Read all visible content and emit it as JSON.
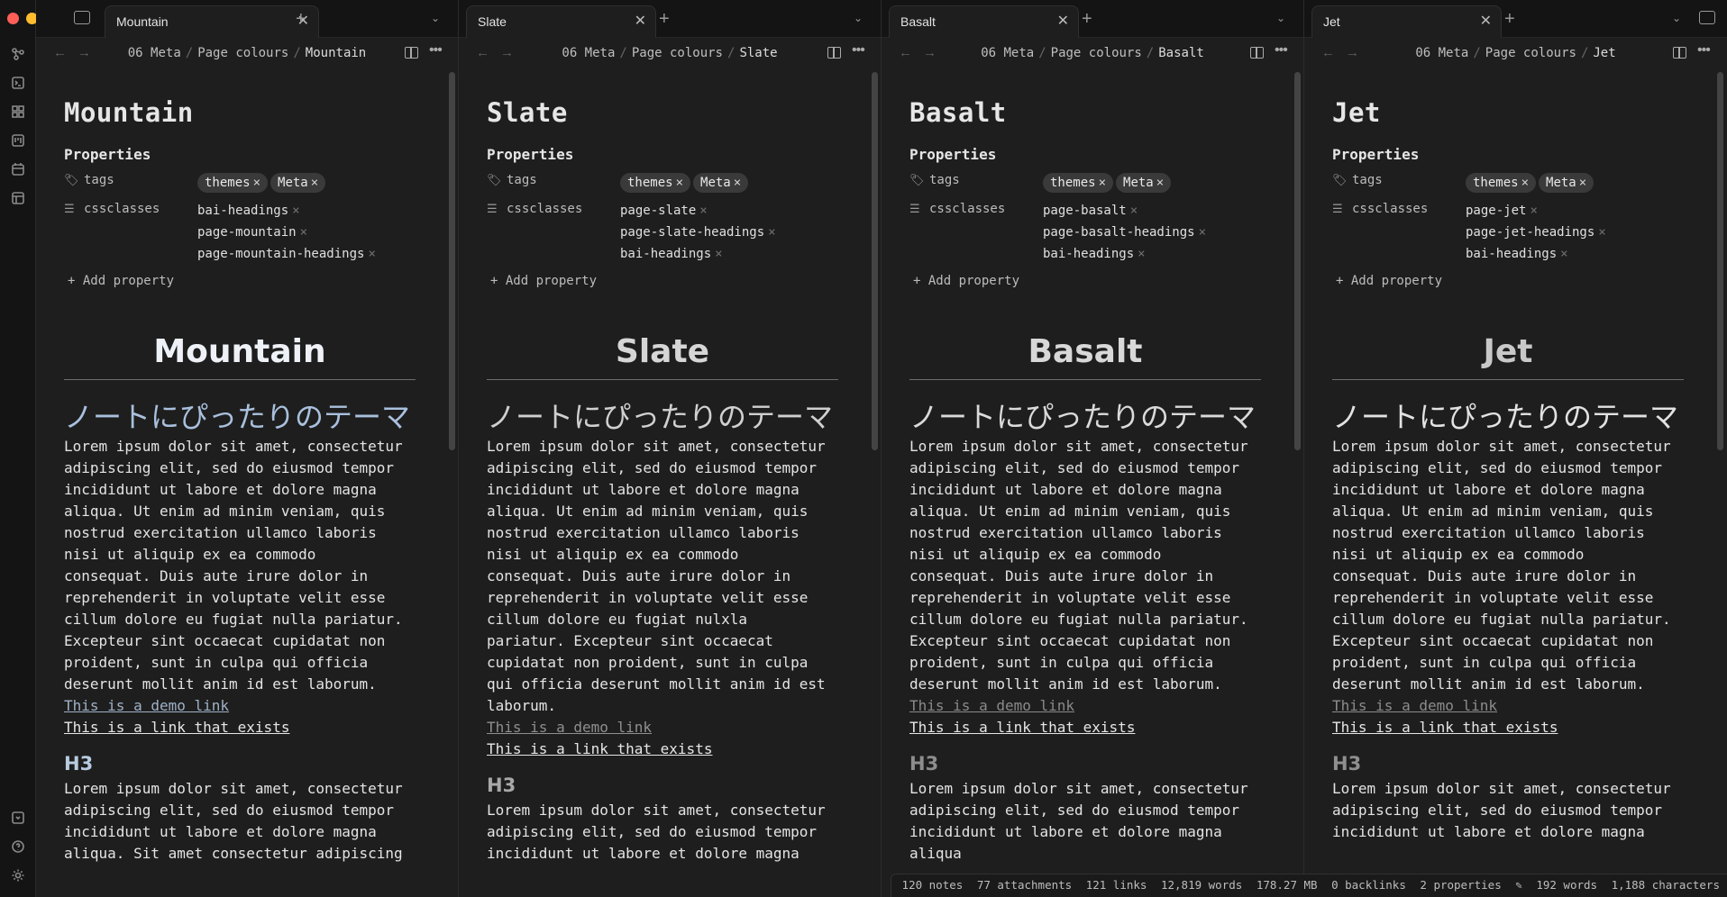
{
  "colors": {
    "mountain_heading": "#eef2f7",
    "mountain_jp": "#a9c0dd",
    "mountain_link": "#9fb2c8",
    "mountain_h3": "#b8cbe0",
    "slate_heading": "#d6d6d6",
    "slate_jp": "#d0d0d0",
    "slate_link": "#8f8f8f",
    "slate_h3": "#a8a8a8",
    "basalt_heading": "#d8d8d8",
    "basalt_jp": "#dadada",
    "basalt_link": "#8a8a8a",
    "basalt_h3": "#8d8d8d",
    "jet_heading": "#c8c8c8",
    "jet_jp": "#e2e2e2",
    "jet_link": "#8c8c8c",
    "jet_h3": "#8f8f8f"
  },
  "ribbon": {
    "icons": [
      "graph-icon",
      "terminal-icon",
      "blocks-icon",
      "kanban-icon",
      "calendar-icon",
      "layout-icon",
      "vault-icon",
      "help-icon",
      "settings-icon"
    ]
  },
  "props_heading": "Properties",
  "tags_key": "tags",
  "cssclasses_key": "cssclasses",
  "add_property": "Add property",
  "tab_close": "✕",
  "tab_new": "+",
  "tag_remove": "×",
  "breadcrumb": {
    "folder": "06 Meta",
    "sub": "Page colours",
    "sep": "/"
  },
  "demo_link": "This is a demo link",
  "exists_link": "This is a link that exists",
  "jp_heading": "ノートにぴったりのテーマ",
  "h3": "H3",
  "panes": [
    {
      "title": "Mountain",
      "tags": [
        "themes",
        "Meta"
      ],
      "cssclasses": [
        "bai-headings",
        "page-mountain",
        "page-mountain-headings"
      ],
      "body": "Lorem ipsum dolor sit amet, consectetur\nadipiscing elit, sed do eiusmod tempor\nincididunt ut labore et dolore magna\naliqua. Ut enim ad minim veniam, quis\nnostrud exercitation ullamco laboris\nnisi ut aliquip ex ea commodo\nconsequat. Duis aute irure dolor in\nreprehenderit in voluptate velit esse\ncillum dolore eu fugiat nulla pariatur.\nExcepteur sint occaecat cupidatat non\nproident, sunt in culpa qui officia\ndeserunt mollit anim id est laborum.",
      "body2": "Lorem ipsum dolor sit amet, consectetur\nadipiscing elit, sed do eiusmod tempor\nincididunt ut labore et dolore magna\naliqua. Sit amet consectetur adipiscing"
    },
    {
      "title": "Slate",
      "tags": [
        "themes",
        "Meta"
      ],
      "cssclasses": [
        "page-slate",
        "page-slate-headings",
        "bai-headings"
      ],
      "body": "Lorem ipsum dolor sit amet, consectetur\nadipiscing elit, sed do eiusmod tempor\nincididunt ut labore et dolore magna\naliqua. Ut enim ad minim veniam, quis\nnostrud exercitation ullamco laboris\nnisi ut aliquip ex ea commodo\nconsequat. Duis aute irure dolor in\nreprehenderit in voluptate velit esse\ncillum dolore eu fugiat nulxla\npariatur. Excepteur sint occaecat\ncupidatat non proident, sunt in culpa\nqui officia deserunt mollit anim id est\nlaborum.",
      "body2": "Lorem ipsum dolor sit amet, consectetur\nadipiscing elit, sed do eiusmod tempor\nincididunt ut labore et dolore magna"
    },
    {
      "title": "Basalt",
      "tags": [
        "themes",
        "Meta"
      ],
      "cssclasses": [
        "page-basalt",
        "page-basalt-headings",
        "bai-headings"
      ],
      "body": "Lorem ipsum dolor sit amet, consectetur\nadipiscing elit, sed do eiusmod tempor\nincididunt ut labore et dolore magna\naliqua. Ut enim ad minim veniam, quis\nnostrud exercitation ullamco laboris\nnisi ut aliquip ex ea commodo\nconsequat. Duis aute irure dolor in\nreprehenderit in voluptate velit esse\ncillum dolore eu fugiat nulla pariatur.\nExcepteur sint occaecat cupidatat non\nproident, sunt in culpa qui officia\ndeserunt mollit anim id est laborum.",
      "body2": "Lorem ipsum dolor sit amet, consectetur\nadipiscing elit, sed do eiusmod tempor\nincididunt ut labore et dolore magna\naliqua"
    },
    {
      "title": "Jet",
      "tags": [
        "themes",
        "Meta"
      ],
      "cssclasses": [
        "page-jet",
        "page-jet-headings",
        "bai-headings"
      ],
      "body": "Lorem ipsum dolor sit amet, consectetur\nadipiscing elit, sed do eiusmod tempor\nincididunt ut labore et dolore magna\naliqua. Ut enim ad minim veniam, quis\nnostrud exercitation ullamco laboris\nnisi ut aliquip ex ea commodo\nconsequat. Duis aute irure dolor in\nreprehenderit in voluptate velit esse\ncillum dolore eu fugiat nulla pariatur.\nExcepteur sint occaecat cupidatat non\nproident, sunt in culpa qui officia\ndeserunt mollit anim id est laborum.",
      "body2": "Lorem ipsum dolor sit amet, consectetur\nadipiscing elit, sed do eiusmod tempor\nincididunt ut labore et dolore magna"
    }
  ],
  "status": {
    "notes": "120 notes",
    "attachments": "77 attachments",
    "links": "121 links",
    "words": "12,819 words",
    "size": "178.27 MB",
    "backlinks": "0 backlinks",
    "properties": "2 properties",
    "note_words": "192 words",
    "characters": "1,188 characters"
  }
}
